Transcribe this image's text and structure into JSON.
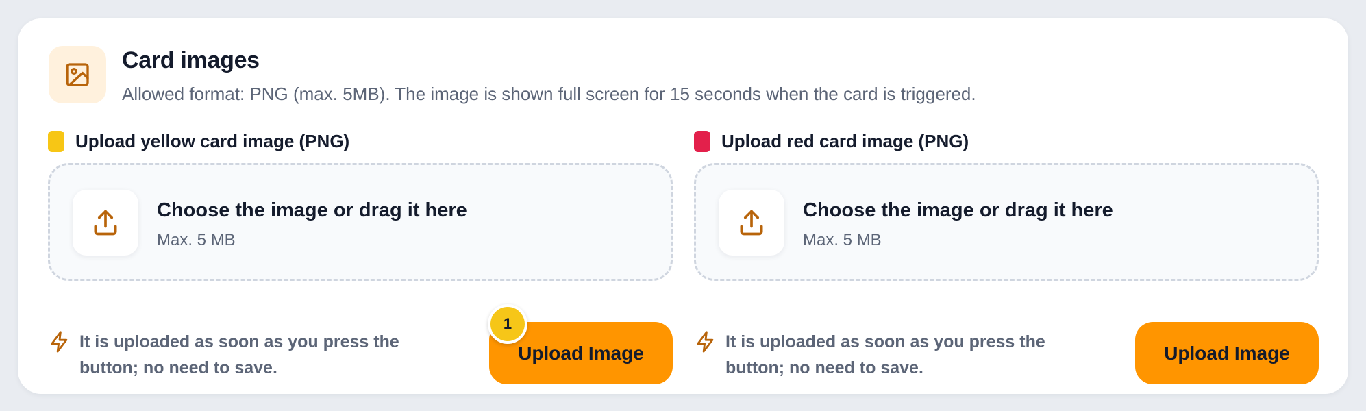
{
  "section": {
    "icon": "image-icon",
    "title": "Card images",
    "subtitle": "Allowed format: PNG (max. 5MB). The image is shown full screen for 15 seconds when the card is triggered."
  },
  "yellow": {
    "label": "Upload yellow card image (PNG)",
    "swatch_color": "#f7c615",
    "dropzone_title": "Choose the image or drag it here",
    "dropzone_sub": "Max. 5 MB",
    "note": "It is uploaded as soon as you press the button; no need to save.",
    "button_label": "Upload Image",
    "badge": "1"
  },
  "red": {
    "label": "Upload red card image (PNG)",
    "swatch_color": "#e3204b",
    "dropzone_title": "Choose the image or drag it here",
    "dropzone_sub": "Max. 5 MB",
    "note": "It is uploaded as soon as you press the button; no need to save.",
    "button_label": "Upload Image"
  },
  "colors": {
    "accent": "#ff9500",
    "icon_brown": "#b8640a",
    "badge": "#f6c618"
  }
}
